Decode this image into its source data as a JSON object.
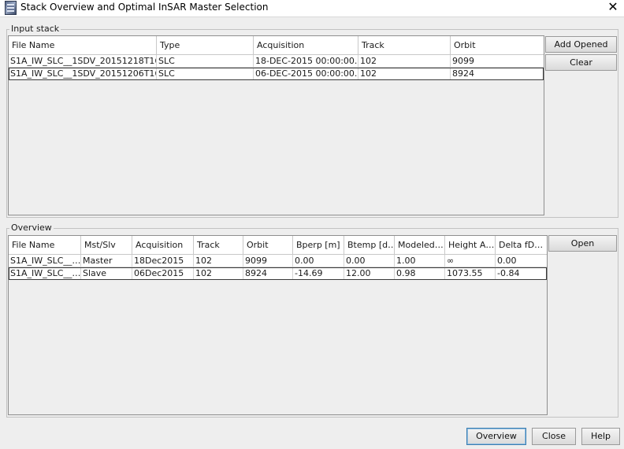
{
  "window": {
    "title": "Stack Overview and Optimal InSAR Master Selection",
    "close_glyph": "✕"
  },
  "input_stack": {
    "label": "Input stack",
    "columns": [
      "File Name",
      "Type",
      "Acquisition",
      "Track",
      "Orbit"
    ],
    "rows": [
      [
        "S1A_IW_SLC__1SDV_20151218T16…",
        "SLC",
        "18-DEC-2015 00:00:00.…",
        "102",
        "9099"
      ],
      [
        "S1A_IW_SLC__1SDV_20151206T16…",
        "SLC",
        "06-DEC-2015 00:00:00.…",
        "102",
        "8924"
      ]
    ],
    "buttons": {
      "add_opened": "Add Opened",
      "clear": "Clear"
    }
  },
  "overview": {
    "label": "Overview",
    "columns": [
      "File Name",
      "Mst/Slv",
      "Acquisition",
      "Track",
      "Orbit",
      "Bperp [m]",
      "Btemp [d…",
      "Modeled…",
      "Height A…",
      "Delta fD…"
    ],
    "rows": [
      [
        "S1A_IW_SLC__…",
        "Master",
        "18Dec2015",
        "102",
        "9099",
        "0.00",
        "0.00",
        "1.00",
        "∞",
        "0.00"
      ],
      [
        "S1A_IW_SLC__…",
        "Slave",
        "06Dec2015",
        "102",
        "8924",
        "-14.69",
        "12.00",
        "0.98",
        "1073.55",
        "-0.84"
      ]
    ],
    "buttons": {
      "open": "Open"
    }
  },
  "footer": {
    "overview": "Overview",
    "close": "Close",
    "help": "Help"
  },
  "icons": {
    "app": "stack-app-icon",
    "close": "close-icon"
  }
}
